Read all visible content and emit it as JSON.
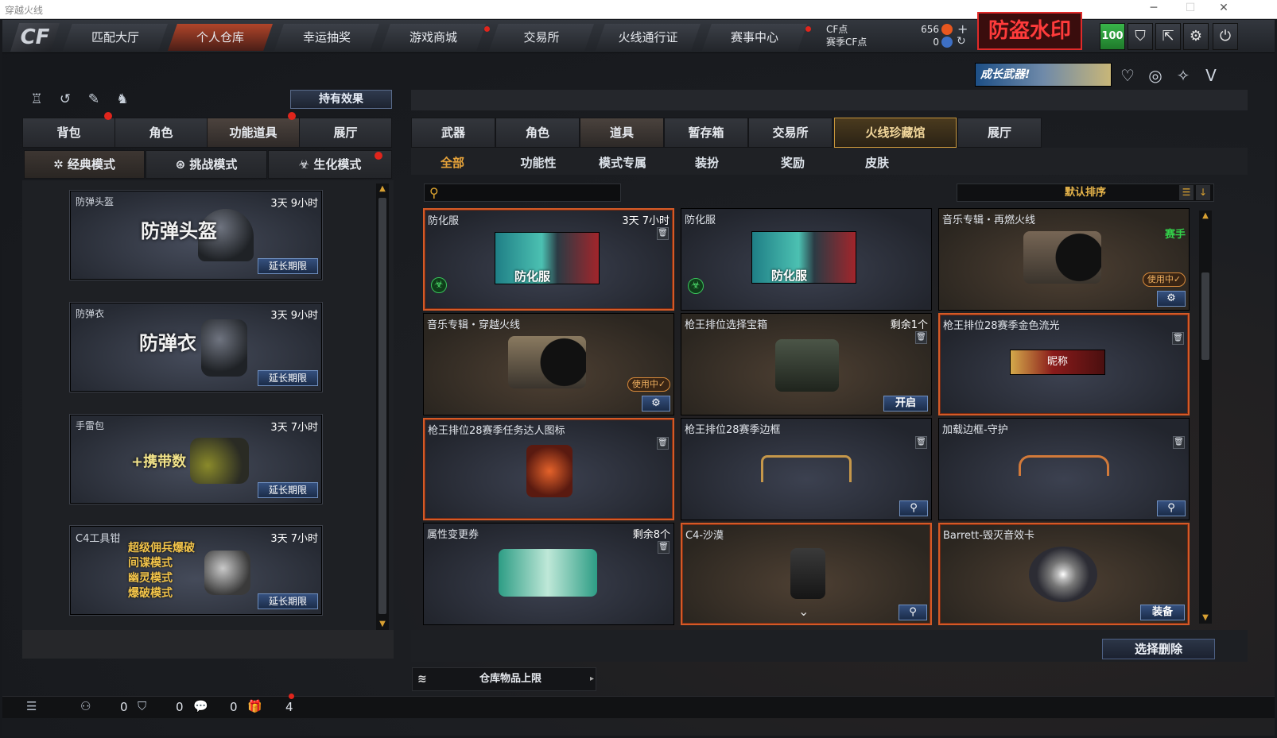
{
  "window": {
    "title": "穿越火线"
  },
  "nav": {
    "tabs": [
      "匹配大厅",
      "个人仓库",
      "幸运抽奖",
      "游戏商城",
      "交易所",
      "火线通行证",
      "赛事中心"
    ],
    "cf_label": "CF点",
    "match_cf_label": "赛季CF点",
    "cf_value": "656",
    "match_cf_value": "0",
    "watermark": "防盗水印",
    "level": "100"
  },
  "banner": {
    "text": "成长武器!"
  },
  "left": {
    "effect_button": "持有效果",
    "tabs": [
      "背包",
      "角色",
      "功能道具",
      "展厅"
    ],
    "modes": [
      "经典模式",
      "挑战模式",
      "生化模式"
    ],
    "items": [
      {
        "name": "防弹头盔",
        "time": "3天 9小时",
        "art": "防弹头盔",
        "extend": "延长期限"
      },
      {
        "name": "防弹衣",
        "time": "3天 9小时",
        "art": "防弹衣",
        "extend": "延长期限"
      },
      {
        "name": "手雷包",
        "time": "3天 7小时",
        "art": "+携带数",
        "extend": "延长期限"
      },
      {
        "name": "C4工具钳",
        "time": "3天 7小时",
        "art_lines": [
          "超级佣兵爆破",
          "间谍模式",
          "幽灵模式",
          "爆破模式"
        ],
        "extend": "延长期限"
      }
    ]
  },
  "right": {
    "tabs": [
      "武器",
      "角色",
      "道具",
      "暂存箱",
      "交易所",
      "火线珍藏馆",
      "展厅"
    ],
    "filters": [
      "全部",
      "功能性",
      "模式专属",
      "装扮",
      "奖励",
      "皮肤"
    ],
    "sort": "默认排序",
    "items": [
      {
        "name": "防化服",
        "time": "3天 7小时",
        "art": "防化服"
      },
      {
        "name": "防化服",
        "art": "防化服"
      },
      {
        "name": "音乐专辑・再燃火线",
        "tag": "赛手",
        "status": "使用中✓"
      },
      {
        "name": "音乐专辑・穿越火线",
        "status": "使用中✓"
      },
      {
        "name": "枪王排位选择宝箱",
        "remain": "剩余1个",
        "button": "开启"
      },
      {
        "name": "枪王排位28赛季金色流光",
        "art": "昵称"
      },
      {
        "name": "枪王排位28赛季任务达人图标"
      },
      {
        "name": "枪王排位28赛季边框"
      },
      {
        "name": "加载边框-守护"
      },
      {
        "name": "属性变更券",
        "remain": "剩余8个"
      },
      {
        "name": "C4-沙漠"
      },
      {
        "name": "Barrett-毁灭音效卡",
        "button": "装备"
      }
    ],
    "delete_button": "选择删除",
    "capacity": "仓库物品上限"
  },
  "bottom": {
    "friends": "0",
    "clan": "0",
    "chat": "0",
    "gifts": "4"
  }
}
